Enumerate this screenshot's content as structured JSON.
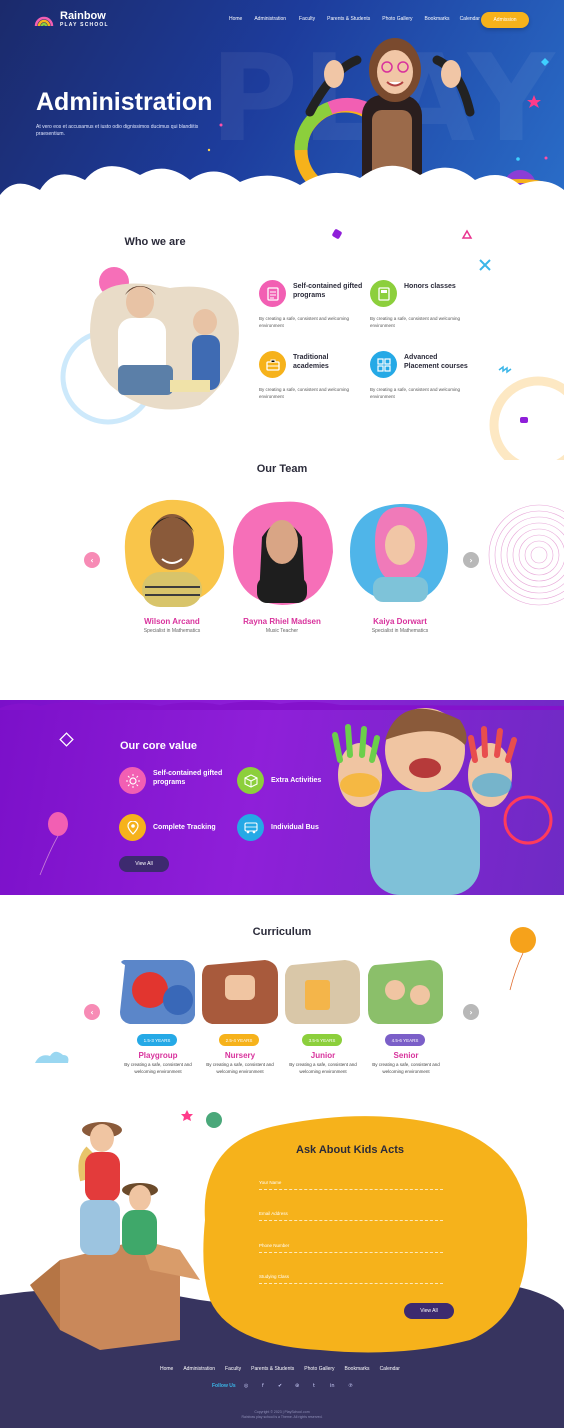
{
  "header": {
    "logo_title": "Rainbow",
    "logo_subtitle": "PLAY SCHOOL",
    "nav": [
      "Home",
      "Administration",
      "Faculty",
      "Parents & Students",
      "Photo Gallery",
      "Bookmarks",
      "Calendar"
    ],
    "cta": "Admission"
  },
  "hero": {
    "title": "Administration",
    "text": "At vero eos et accusamus et iusto odio dignissimos ducimus qui blandiitis praesentium.",
    "watermark": "PLAY"
  },
  "who": {
    "title": "Who we are",
    "features": [
      {
        "title": "Self-contained gifted programs",
        "text": "By creating a safe, consistent and welcoming environment",
        "color": "#f25fb3",
        "icon": "document-icon"
      },
      {
        "title": "Honors classes",
        "text": "By creating a safe, consistent and welcoming environment",
        "color": "#8ccf3c",
        "icon": "book-icon"
      },
      {
        "title": "Traditional academies",
        "text": "By creating a safe, consistent and welcoming environment",
        "color": "#f6b21b",
        "icon": "briefcase-icon"
      },
      {
        "title": "Advanced Placement courses",
        "text": "By creating a safe, consistent and welcoming environment",
        "color": "#25a9e6",
        "icon": "grid-icon"
      }
    ]
  },
  "team": {
    "title": "Our Team",
    "members": [
      {
        "name": "Wilson Arcand",
        "role": "Specialist in Mathematics",
        "color": "#f9c54a"
      },
      {
        "name": "Rayna Rhiel Madsen",
        "role": "Music Teacher",
        "color": "#f66fb8"
      },
      {
        "name": "Kaiya Dorwart",
        "role": "Specialist in Mathematics",
        "color": "#4fb5e9"
      }
    ]
  },
  "core": {
    "title": "Our core value",
    "items": [
      {
        "title": "Self-contained gifted programs",
        "color": "#f25fb3",
        "icon": "sun-icon"
      },
      {
        "title": "Extra Activities",
        "color": "#8ccf3c",
        "icon": "cube-icon"
      },
      {
        "title": "Complete Tracking",
        "color": "#f6b21b",
        "icon": "location-pin-icon"
      },
      {
        "title": "Individual Bus",
        "color": "#25a9e6",
        "icon": "bus-icon"
      }
    ],
    "button": "View All"
  },
  "curriculum": {
    "title": "Curriculum",
    "items": [
      {
        "age": "1.5-3 YEARS",
        "name": "Playgroup",
        "text": "By creating a safe, consistent and welcoming environment",
        "color": "#25a9e6"
      },
      {
        "age": "2.5-4 YEARS",
        "name": "Nursery",
        "text": "By creating a safe, consistent and welcoming environment",
        "color": "#f6b21b"
      },
      {
        "age": "3.5-5 YEARS",
        "name": "Junior",
        "text": "By creating a safe, consistent and welcoming environment",
        "color": "#8ccf3c"
      },
      {
        "age": "4.5-6 YEARS",
        "name": "Senior",
        "text": "By creating a safe, consistent and welcoming environment",
        "color": "#7b5fc8"
      }
    ]
  },
  "form": {
    "title": "Ask About Kids Acts",
    "fields": [
      "Your Name",
      "Email Address",
      "Phone Number",
      "Studying Class"
    ],
    "button": "View All"
  },
  "footer": {
    "nav": [
      "Home",
      "Administration",
      "Faculty",
      "Parents & Students",
      "Photo Gallery",
      "Bookmarks",
      "Calendar"
    ],
    "follow": "Follow Us",
    "social": [
      "instagram-icon",
      "facebook-icon",
      "twitter-icon",
      "dribbble-icon",
      "tumblr-icon",
      "linkedin-icon",
      "pinterest-icon"
    ],
    "copyright1": "Copyright © 2023 | PlaySchool.com",
    "copyright2": "Rainbow play school is a Theme. All rights reserved."
  }
}
